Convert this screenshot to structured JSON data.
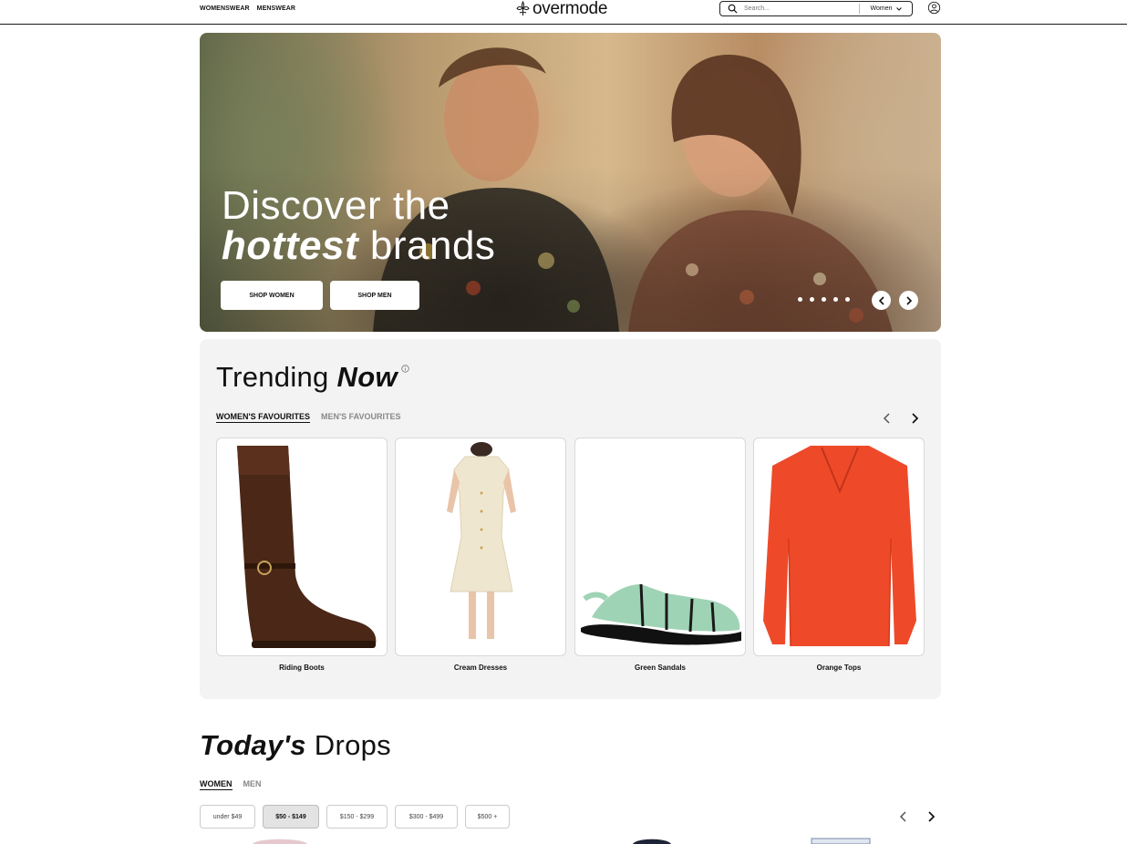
{
  "header": {
    "nav": [
      "WOMENSWEAR",
      "MENSWEAR"
    ],
    "logo": "overmode",
    "search_placeholder": "Search...",
    "gender_select": "Women"
  },
  "hero": {
    "title_line1": "Discover the",
    "title_em": "hottest",
    "title_rest": " brands",
    "btn_women": "SHOP WOMEN",
    "btn_men": "SHOP MEN",
    "slide_count": 5
  },
  "trending": {
    "title": "Trending ",
    "title_em": "Now",
    "tabs": [
      "WOMEN'S FAVOURITES",
      "MEN'S FAVOURITES"
    ],
    "products": [
      {
        "label": "Riding Boots",
        "icon": "riding-boot-image"
      },
      {
        "label": "Cream Dresses",
        "icon": "cream-dress-image"
      },
      {
        "label": "Green Sandals",
        "icon": "green-sandal-image"
      },
      {
        "label": "Orange Tops",
        "icon": "orange-top-image"
      }
    ]
  },
  "drops": {
    "title_em": "Today's",
    "title_rest": " Drops",
    "tabs": [
      "WOMEN",
      "MEN"
    ],
    "price_filters": [
      "under $49",
      "$50 - $149",
      "$150 - $299",
      "$300 - $499",
      "$500 +"
    ],
    "selected_filter": "$50 - $149"
  },
  "colors": {
    "text": "#111111",
    "muted": "#888888",
    "panel": "#f3f3f3",
    "sandal_green": "#9fd3b5",
    "top_orange": "#ee4a2a",
    "boot_brown": "#4a2716"
  }
}
